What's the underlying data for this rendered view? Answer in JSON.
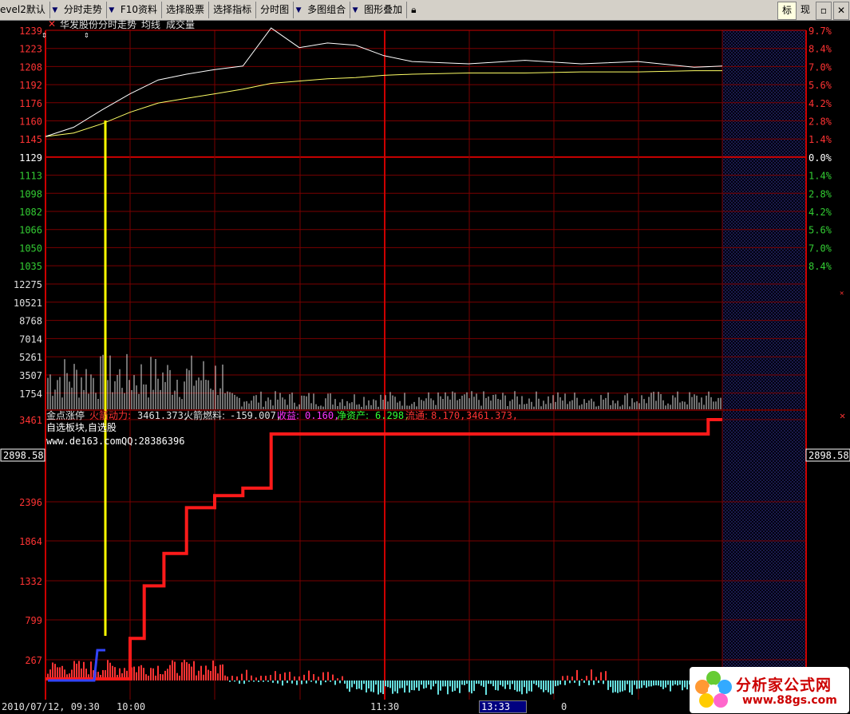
{
  "toolbar": {
    "level2": "evel2默认",
    "items": [
      "分时走势",
      "F10资料",
      "选择股票",
      "选择指标",
      "分时图",
      "多图组合",
      "图形叠加"
    ],
    "right_biao": "标",
    "right_xian": "现"
  },
  "price_panel": {
    "title": "华发股份分时走势",
    "avg_label": "均线",
    "vol_label": "成交量",
    "left_ticks": [
      "1239",
      "1223",
      "1208",
      "1192",
      "1176",
      "1160",
      "1145",
      "1129",
      "1113",
      "1098",
      "1082",
      "1066",
      "1050",
      "1035"
    ],
    "right_ticks": [
      "9.7%",
      "8.4%",
      "7.0%",
      "5.6%",
      "4.2%",
      "2.8%",
      "1.4%",
      "0.0%",
      "1.4%",
      "2.8%",
      "4.2%",
      "5.6%",
      "7.0%",
      "8.4%"
    ]
  },
  "volume_panel": {
    "ticks": [
      "12275",
      "10521",
      "8768",
      "7014",
      "5261",
      "3507",
      "1754"
    ]
  },
  "indicator_panel": {
    "name": "金点涨停",
    "fields": [
      {
        "label": "火箭动力:",
        "value": "3461.373,"
      },
      {
        "label": "火箭燃料:",
        "value": "-159.007,"
      },
      {
        "label": "收益:",
        "value": "0.160,"
      },
      {
        "label": "净资产:",
        "value": "6.298,"
      },
      {
        "label": "流通:",
        "value": "8.170,"
      },
      {
        "label": "",
        "value": "3461.373,"
      }
    ],
    "line2": "自选板块,自选股",
    "url": "www.de163.com",
    "qq": "QQ:28386396",
    "ticks": [
      "3461",
      "2396",
      "1864",
      "1332",
      "799",
      "267"
    ],
    "marker": "2898.58"
  },
  "footer": {
    "date": "2010/07/12, 09:30",
    "t1000": "10:00",
    "t1130": "11:30",
    "cursor_time": "13:33",
    "cursor_val": "0"
  },
  "logo": {
    "cn": "分析家公式网",
    "url": "www.88gs.com"
  },
  "colors": {
    "grid": "#7a0000",
    "axis_up": "#ff3333",
    "axis_down": "#33cc33",
    "price_line": "#ffffff",
    "avg_line": "#ffff66",
    "rocket": "#ff1a1a",
    "signal": "#ffff00",
    "neg_bar": "#66e0e0"
  },
  "chart_data": [
    {
      "type": "line",
      "title": "华发股份分时走势",
      "series": [
        {
          "name": "分时走势",
          "x": [
            "09:30",
            "09:40",
            "09:50",
            "10:00",
            "10:10",
            "10:20",
            "10:30",
            "10:40",
            "10:50",
            "11:00",
            "11:10",
            "11:20",
            "11:30",
            "13:10",
            "13:30",
            "13:50",
            "14:10",
            "14:30",
            "14:50",
            "15:00"
          ],
          "values": [
            1147,
            1155,
            1170,
            1184,
            1196,
            1201,
            1205,
            1208,
            1241,
            1224,
            1228,
            1226,
            1217,
            1212,
            1210,
            1213,
            1210,
            1212,
            1207,
            1208
          ]
        },
        {
          "name": "均线",
          "x": [
            "09:30",
            "09:40",
            "09:50",
            "10:00",
            "10:10",
            "10:20",
            "10:30",
            "10:40",
            "10:50",
            "11:00",
            "11:10",
            "11:20",
            "11:30",
            "13:10",
            "13:30",
            "13:50",
            "14:10",
            "14:30",
            "14:50",
            "15:00"
          ],
          "values": [
            1147,
            1150,
            1158,
            1168,
            1176,
            1180,
            1184,
            1188,
            1193,
            1195,
            1197,
            1198,
            1200,
            1201,
            1202,
            1202,
            1203,
            1203,
            1204,
            1204
          ]
        }
      ],
      "ylim": [
        1035,
        1239
      ]
    },
    {
      "type": "bar",
      "title": "成交量",
      "ylim": [
        0,
        12275
      ]
    },
    {
      "type": "line",
      "title": "金点涨停",
      "series": [
        {
          "name": "火箭动力",
          "x": [
            "09:30",
            "09:45",
            "09:52",
            "10:00",
            "10:05",
            "10:12",
            "10:20",
            "10:30",
            "10:40",
            "10:50",
            "11:00",
            "11:30",
            "14:50",
            "14:55",
            "15:00"
          ],
          "values": [
            0,
            0,
            0,
            550,
            1250,
            1680,
            2290,
            2450,
            2550,
            3270,
            3270,
            3270,
            3270,
            3461,
            3461
          ]
        }
      ],
      "ylim": [
        0,
        3461
      ]
    }
  ]
}
